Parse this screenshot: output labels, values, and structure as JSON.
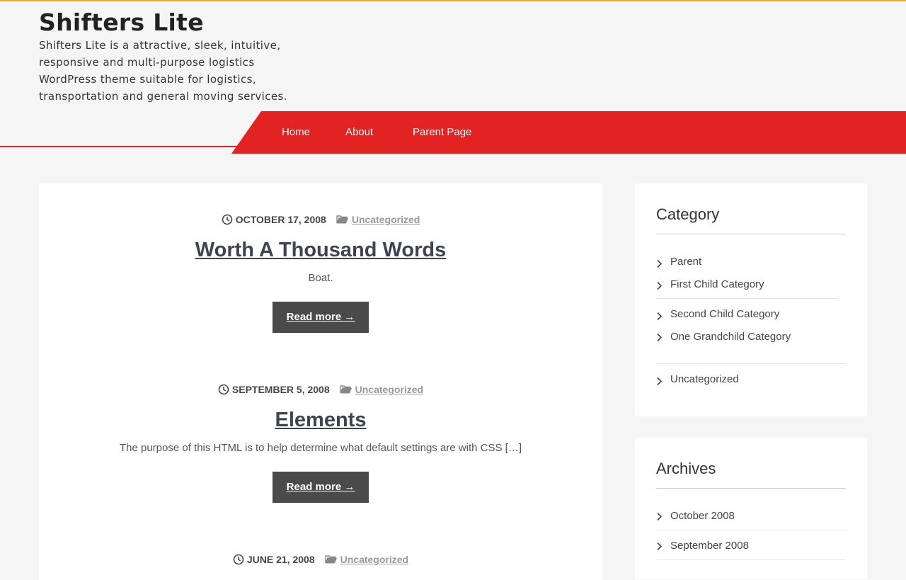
{
  "site": {
    "title": "Shifters Lite",
    "description": "Shifters Lite is a attractive, sleek, intuitive, responsive and multi-purpose logistics WordPress theme suitable for logistics, transportation and general moving services."
  },
  "nav": {
    "items": [
      {
        "label": "Home"
      },
      {
        "label": "About"
      },
      {
        "label": "Parent Page"
      }
    ]
  },
  "posts": [
    {
      "date": "OCTOBER 17, 2008",
      "category": "Uncategorized",
      "title": "Worth A Thousand Words",
      "excerpt": "Boat.",
      "read_more": "Read more →"
    },
    {
      "date": "SEPTEMBER 5, 2008",
      "category": "Uncategorized",
      "title": "Elements",
      "excerpt": "The purpose of this HTML is to help determine what default settings are with CSS […]",
      "read_more": "Read more →"
    },
    {
      "date": "JUNE 21, 2008",
      "category": "Uncategorized"
    }
  ],
  "sidebar": {
    "category": {
      "title": "Category",
      "items": [
        "Parent",
        "First Child Category",
        "Second Child Category",
        "One Grandchild Category",
        "Uncategorized"
      ]
    },
    "archives": {
      "title": "Archives",
      "items": [
        "October 2008",
        "September 2008"
      ]
    }
  },
  "colors": {
    "accent": "#e32222",
    "top_bar": "#f6a623",
    "button": "#4a4a4a",
    "title": "#3d4555"
  },
  "icons": [
    "clock-icon",
    "folder-icon",
    "chevron-right-icon"
  ]
}
